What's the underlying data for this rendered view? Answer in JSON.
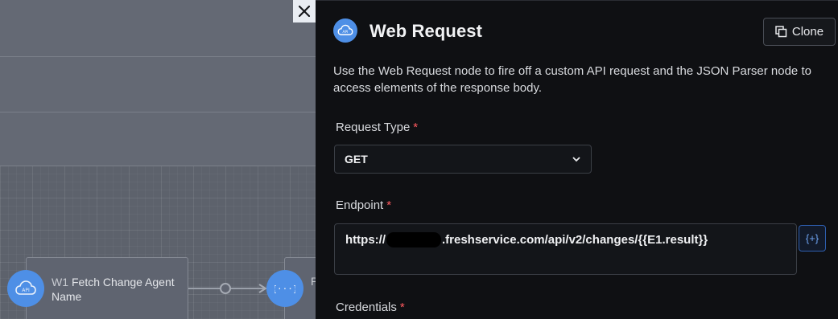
{
  "canvas": {
    "nodes": [
      {
        "id_label": "W1",
        "title": "Fetch Change Agent Name",
        "icon": "api-cloud-icon"
      },
      {
        "id_label": "",
        "title": "P",
        "icon": "json-parser-icon"
      }
    ],
    "close_icon": "close-icon"
  },
  "panel": {
    "title": "Web Request",
    "header_icon": "api-cloud-icon",
    "clone_label": "Clone",
    "description": "Use the Web Request node to fire off a custom API request and the JSON Parser node to access elements of the response body.",
    "fields": {
      "request_type": {
        "label": "Request Type",
        "required_mark": "*",
        "value": "GET"
      },
      "endpoint": {
        "label": "Endpoint",
        "required_mark": "*",
        "value_prefix": "https://",
        "value_suffix": ".freshservice.com/api/v2/changes/{{E1.result}}",
        "insert_variable_label": "{+}"
      },
      "credentials": {
        "label": "Credentials",
        "required_mark": "*"
      }
    }
  },
  "colors": {
    "accent": "#4e8fe6",
    "panel_bg": "#0f1013",
    "canvas_bg": "#646974",
    "required": "#ff5a5f"
  }
}
